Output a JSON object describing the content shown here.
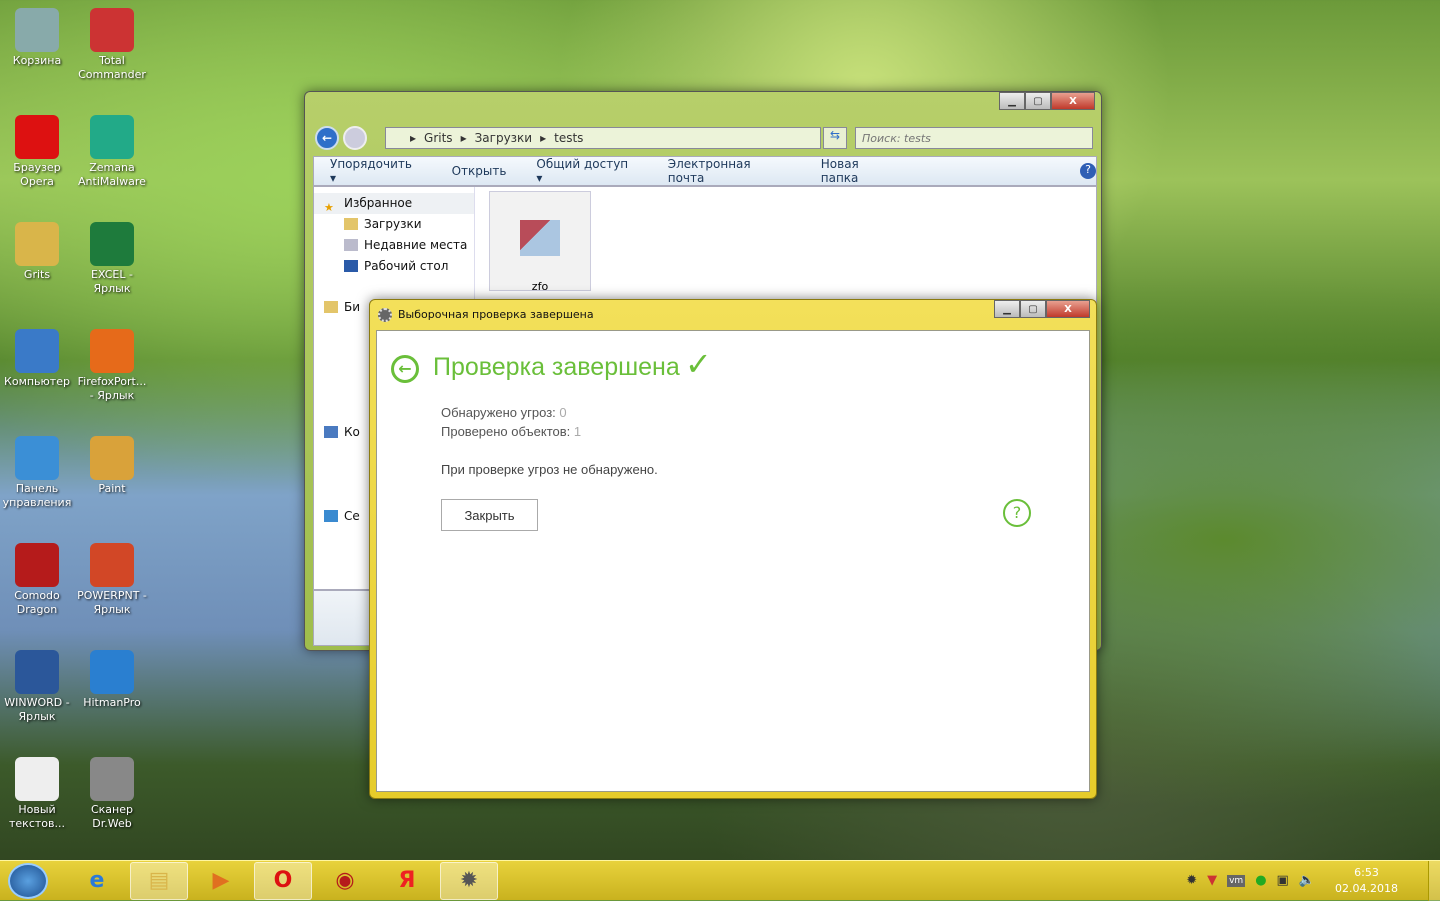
{
  "desktop": {
    "icons": [
      {
        "label": "Корзина",
        "color": "#8aa"
      },
      {
        "label": "Total Commander",
        "color": "#c33"
      },
      {
        "label": "Браузер Opera",
        "color": "#d11"
      },
      {
        "label": "Zemana AntiMalware",
        "color": "#2a8"
      },
      {
        "label": "Grits",
        "color": "#d9b54a"
      },
      {
        "label": "EXCEL - Ярлык",
        "color": "#1e7b3c"
      },
      {
        "label": "Компьютер",
        "color": "#3a7ac8"
      },
      {
        "label": "FirefoxPort... - Ярлык",
        "color": "#e66a1a"
      },
      {
        "label": "Панель управления",
        "color": "#3b8fd6"
      },
      {
        "label": "Paint",
        "color": "#d9a23a"
      },
      {
        "label": "Comodo Dragon",
        "color": "#b51b1b"
      },
      {
        "label": "POWERPNT - Ярлык",
        "color": "#d24726"
      },
      {
        "label": "WINWORD - Ярлык",
        "color": "#2b579a"
      },
      {
        "label": "HitmanPro",
        "color": "#2a7fd0"
      },
      {
        "label": "Новый текстов...",
        "color": "#eee"
      },
      {
        "label": "Сканер Dr.Web",
        "color": "#888"
      }
    ]
  },
  "explorer": {
    "breadcrumb": [
      "Grits",
      "Загрузки",
      "tests"
    ],
    "search_placeholder": "Поиск: tests",
    "toolbar": {
      "organize": "Упорядочить",
      "open": "Открыть",
      "share": "Общий доступ",
      "email": "Электронная почта",
      "new_folder": "Новая папка"
    },
    "nav": {
      "favorites": "Избранное",
      "downloads": "Загрузки",
      "recent": "Недавние места",
      "desktop": "Рабочий стол",
      "libraries": "Би",
      "computer": "Ко",
      "network": "Се"
    },
    "file_name": "zfo"
  },
  "dialog": {
    "title": "Выборочная проверка завершена",
    "heading": "Проверка завершена",
    "threats_label": "Обнаружено угроз:",
    "threats_value": "0",
    "checked_label": "Проверено объектов:",
    "checked_value": "1",
    "message": "При проверке угроз не обнаружено.",
    "close_button": "Закрыть",
    "help": "?",
    "accent": "#6abf3a"
  },
  "taskbar": {
    "time": "6:53",
    "date": "02.04.2018",
    "tray_vm": "vm"
  }
}
